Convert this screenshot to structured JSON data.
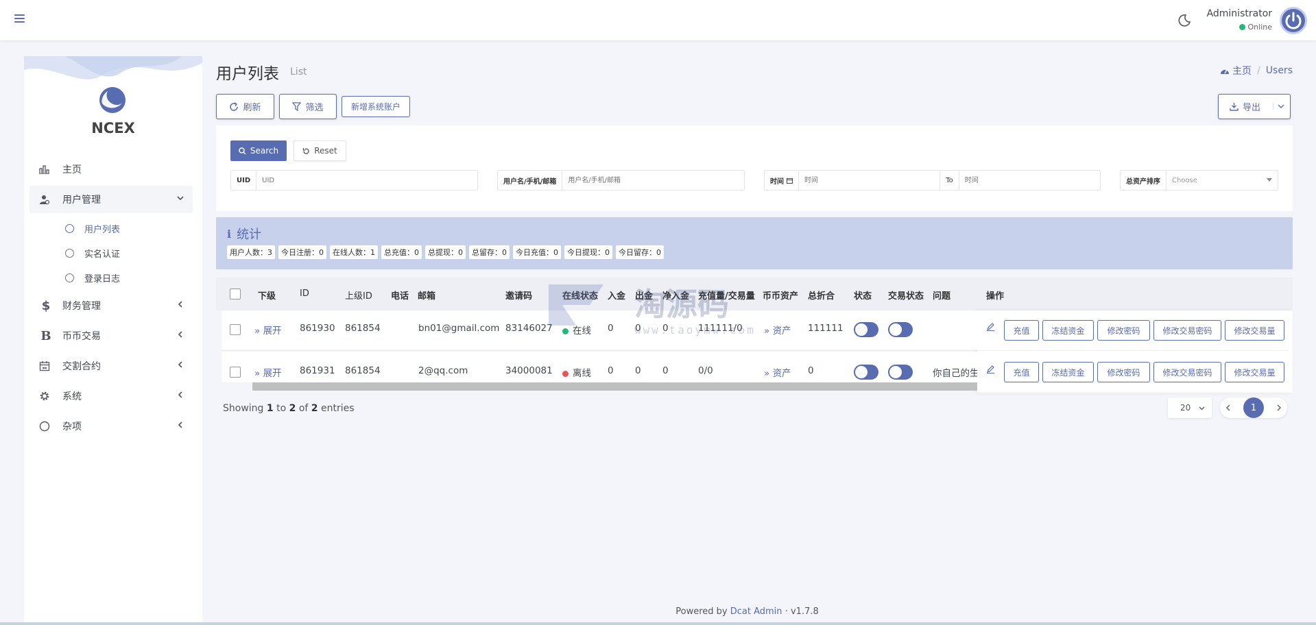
{
  "navbar": {
    "user_name": "Administrator",
    "user_status": "Online",
    "colors": {
      "accent": "#586cb1",
      "online": "#21b978"
    }
  },
  "sidebar": {
    "brand": "NCEX",
    "items": [
      {
        "label": "主页",
        "icon": "bar-chart-icon"
      },
      {
        "label": "用户管理",
        "icon": "user-manage-icon"
      },
      {
        "label": "财务管理",
        "icon": "dollar-icon"
      },
      {
        "label": "币币交易",
        "icon": "bitcoin-icon"
      },
      {
        "label": "交割合约",
        "icon": "calendar-icon"
      },
      {
        "label": "系统",
        "icon": "gear-icon"
      },
      {
        "label": "杂项",
        "icon": "circle-icon"
      }
    ],
    "sub_items": [
      "用户列表",
      "实名认证",
      "登录日志"
    ]
  },
  "page": {
    "title": "用户列表",
    "subtitle": "List",
    "breadcrumb_home": "主页",
    "breadcrumb_sep": "/",
    "breadcrumb_current": "Users"
  },
  "toolbar": {
    "refresh": "刷新",
    "filter": "筛选",
    "new_account": "新增系统账户",
    "export": "导出"
  },
  "filter": {
    "search": "Search",
    "reset": "Reset",
    "uid_label": "UID",
    "uid_placeholder": "UID",
    "name_label": "用户名/手机/邮箱",
    "name_placeholder": "用户名/手机/邮箱",
    "time_label": "时间",
    "time_placeholder": "时间",
    "to_label": "To",
    "time_end_placeholder": "时间",
    "sort_label": "总资产排序",
    "sort_value": "Choose"
  },
  "stats": {
    "title": "统计",
    "tags": [
      "用户人数：3",
      "今日注册：0",
      "在线人数：1",
      "总充值：0",
      "总提现：0",
      "总留存：0",
      "今日充值：0",
      "今日提现：0",
      "今日留存：0"
    ]
  },
  "table": {
    "headers": [
      "下级",
      "ID",
      "上级ID",
      "电话",
      "邮箱",
      "邀请码",
      "在线状态",
      "入金",
      "出金",
      "净入金",
      "充值量/交易量",
      "币币资产",
      "总折合",
      "状态",
      "交易状态",
      "问题",
      "操作"
    ],
    "rows": [
      {
        "expand": "展开",
        "id": "861930",
        "parent_id": "861854",
        "phone": "",
        "email": "bn01@gmail.com",
        "invite": "83146027",
        "online": "在线",
        "online_color": "#21b978",
        "deposit": "0",
        "withdraw": "0",
        "net": "0",
        "volume": "111111/0",
        "assets": "资产",
        "total": "111111",
        "question": ""
      },
      {
        "expand": "展开",
        "id": "861931",
        "parent_id": "861854",
        "phone": "",
        "email": "2@qq.com",
        "invite": "34000081",
        "online": "离线",
        "online_color": "#ea5455",
        "deposit": "0",
        "withdraw": "0",
        "net": "0",
        "volume": "0/0",
        "assets": "资产",
        "total": "0",
        "question": "你自己的生"
      }
    ],
    "actions": [
      "充值",
      "冻结资金",
      "修改密码",
      "修改交易密码",
      "修改交易量"
    ]
  },
  "pagination": {
    "showing_prefix": "Showing",
    "from": "1",
    "to_word": "to",
    "to": "2",
    "of_word": "of",
    "total": "2",
    "entries_word": "entries",
    "per_page": "20",
    "current_page": "1"
  },
  "watermark": {
    "text": "淘源码",
    "url": "www.taoymw.com"
  },
  "footer": {
    "powered_by": "Powered by",
    "brand": "Dcat Admin",
    "separator": "·",
    "version": "v1.7.8"
  }
}
